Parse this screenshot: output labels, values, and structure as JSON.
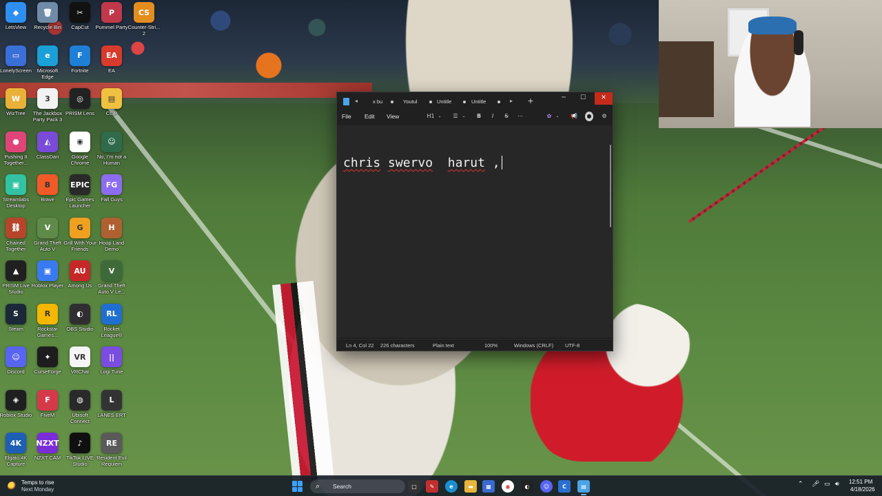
{
  "desktop_icons": [
    {
      "label": "LetsView",
      "bg": "#2f8ff0",
      "glyph": "◆"
    },
    {
      "label": "Recycle Bin",
      "bg": "#6f8ba8",
      "glyph": "🗑"
    },
    {
      "label": "CapCut",
      "bg": "#111111",
      "glyph": "✂"
    },
    {
      "label": "Pummel Party",
      "bg": "#c0394b",
      "glyph": "P"
    },
    {
      "label": "Counter-Stri... 2",
      "bg": "#e48d1f",
      "glyph": "CS"
    },
    {
      "label": "LonelyScreen",
      "bg": "#3a6fd8",
      "glyph": "▭"
    },
    {
      "label": "Microsoft Edge",
      "bg": "#1a9fd6",
      "glyph": "e"
    },
    {
      "label": "Fortnite",
      "bg": "#1e7fd6",
      "glyph": "F"
    },
    {
      "label": "EA",
      "bg": "#d83a2c",
      "glyph": "EA"
    },
    {
      "label": "WizTree",
      "bg": "#e9b13a",
      "glyph": "W"
    },
    {
      "label": "The Jackbox Party Pack 3",
      "bg": "#f2f2f2",
      "glyph": "3"
    },
    {
      "label": "PRISM Lens",
      "bg": "#222222",
      "glyph": "◎"
    },
    {
      "label": "CLIP",
      "bg": "#f0c040",
      "glyph": "▤"
    },
    {
      "label": "Pushing It Together...",
      "bg": "#e0457a",
      "glyph": "●"
    },
    {
      "label": "ClassDan",
      "bg": "#7a4ad8",
      "glyph": "◭"
    },
    {
      "label": "Google Chrome",
      "bg": "#ffffff",
      "glyph": "◉"
    },
    {
      "label": "No, I'm not a Human",
      "bg": "#2f6b4a",
      "glyph": "☺"
    },
    {
      "label": "Streamlabs Desktop",
      "bg": "#31c3a2",
      "glyph": "▣"
    },
    {
      "label": "Brave",
      "bg": "#f05a28",
      "glyph": "B"
    },
    {
      "label": "Epic Games Launcher",
      "bg": "#2a2a2a",
      "glyph": "EPIC"
    },
    {
      "label": "Fall Guys",
      "bg": "#8c6cf0",
      "glyph": "FG"
    },
    {
      "label": "Chained Together",
      "bg": "#b7452a",
      "glyph": "⛓"
    },
    {
      "label": "Grand Theft Auto V",
      "bg": "#5f8a4a",
      "glyph": "V"
    },
    {
      "label": "Grill With Your Friends",
      "bg": "#f0a020",
      "glyph": "G"
    },
    {
      "label": "Hoop Land Demo",
      "bg": "#b06030",
      "glyph": "H"
    },
    {
      "label": "PRISM Live Studio",
      "bg": "#202020",
      "glyph": "▲"
    },
    {
      "label": "Roblox Player",
      "bg": "#3a7af0",
      "glyph": "▣"
    },
    {
      "label": "Among Us",
      "bg": "#c62828",
      "glyph": "AU"
    },
    {
      "label": "Grand Theft Auto V Le...",
      "bg": "#3e6a3a",
      "glyph": "V"
    },
    {
      "label": "Steam",
      "bg": "#1b2838",
      "glyph": "S"
    },
    {
      "label": "Rockstar Games...",
      "bg": "#f6b700",
      "glyph": "R"
    },
    {
      "label": "OBS Studio",
      "bg": "#302e31",
      "glyph": "◐"
    },
    {
      "label": "Rocket League®",
      "bg": "#1f6fd0",
      "glyph": "RL"
    },
    {
      "label": "Discord",
      "bg": "#5865f2",
      "glyph": "☺"
    },
    {
      "label": "CurseForge",
      "bg": "#1d1d1d",
      "glyph": "✦"
    },
    {
      "label": "VRChat",
      "bg": "#f5f5f5",
      "glyph": "VR"
    },
    {
      "label": "Logi Tune",
      "bg": "#7a4ce0",
      "glyph": "||"
    },
    {
      "label": "Roblox Studio",
      "bg": "#1f1f1f",
      "glyph": "◈"
    },
    {
      "label": "FiveM",
      "bg": "#d63a4a",
      "glyph": "F"
    },
    {
      "label": "Ubisoft Connect",
      "bg": "#2a2a2a",
      "glyph": "◍"
    },
    {
      "label": "LANES ERT",
      "bg": "#333333",
      "glyph": "L"
    },
    {
      "label": "Elgato 4K Capture",
      "bg": "#1e5fb3",
      "glyph": "4K"
    },
    {
      "label": "NZXT CAM",
      "bg": "#7b2cd9",
      "glyph": "NZXT"
    },
    {
      "label": "TikTok LIVE Studio",
      "bg": "#101010",
      "glyph": "♪"
    },
    {
      "label": "Resident Evil Requiem",
      "bg": "#5a5a5a",
      "glyph": "RE"
    }
  ],
  "notepad": {
    "tabs": [
      "x bu",
      "Youtul",
      "Untitle",
      "Untitle"
    ],
    "add_tab": "+",
    "menu": {
      "file": "File",
      "edit": "Edit",
      "view": "View"
    },
    "toolbar": {
      "heading": "H1",
      "bold": "B",
      "italic": "I",
      "strike": "S"
    },
    "content": {
      "w1": "chris",
      "w2": "swervo",
      "w3": "harut",
      "tail": " ,"
    },
    "status": {
      "position": "Ln 4, Col 22",
      "chars": "226 characters",
      "format": "Plain text",
      "zoom": "100%",
      "line_ending": "Windows (CRLF)",
      "encoding": "UTF-8"
    }
  },
  "taskbar": {
    "weather_line1": "Temps to rise",
    "weather_line2": "Next Monday",
    "search_label": "Search",
    "time": "12:51 PM",
    "date": "4/18/2026"
  }
}
